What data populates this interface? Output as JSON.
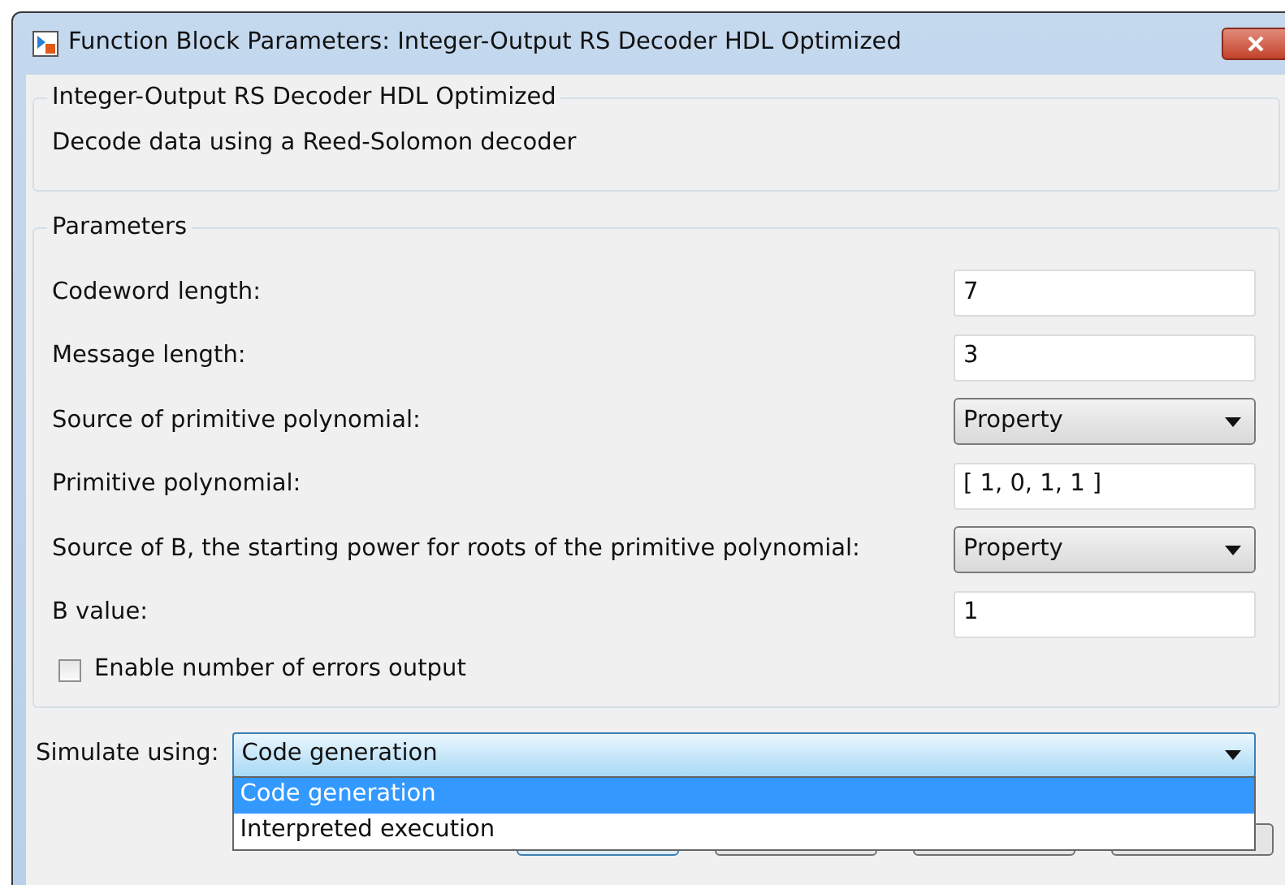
{
  "window": {
    "title": "Function Block Parameters: Integer-Output RS Decoder HDL Optimized"
  },
  "description_group": {
    "title": "Integer-Output RS Decoder HDL Optimized",
    "text": "Decode data using a Reed-Solomon decoder"
  },
  "parameters": {
    "title": "Parameters",
    "items": [
      {
        "kind": "text",
        "label": "Codeword length:",
        "value": "7"
      },
      {
        "kind": "text",
        "label": "Message length:",
        "value": "3"
      },
      {
        "kind": "dropdown",
        "label": "Source of primitive polynomial:",
        "value": "Property"
      },
      {
        "kind": "text",
        "label": "Primitive polynomial:",
        "value": "[ 1, 0, 1, 1 ]"
      },
      {
        "kind": "dropdown",
        "label": "Source of B, the starting power for roots of the primitive polynomial:",
        "value": "Property"
      },
      {
        "kind": "text",
        "label": "B value:",
        "value": "1"
      },
      {
        "kind": "checkbox",
        "label": "Enable number of errors output",
        "checked": false
      }
    ]
  },
  "simulate": {
    "label": "Simulate using:",
    "value": "Code generation",
    "expanded": true,
    "options": [
      {
        "label": "Code generation",
        "selected": true
      },
      {
        "label": "Interpreted execution",
        "selected": false
      }
    ]
  }
}
